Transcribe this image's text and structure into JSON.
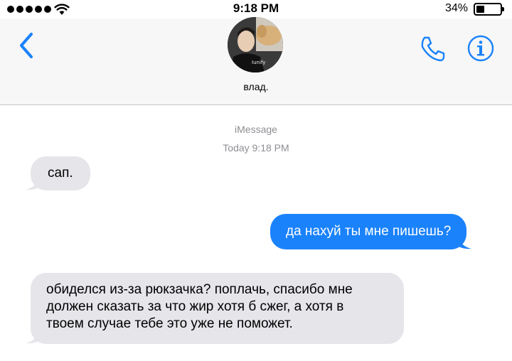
{
  "status_bar": {
    "time": "9:18 PM",
    "battery_percent": "34%",
    "battery_level": 0.34,
    "signal_bars": 5
  },
  "header": {
    "contact_name": "влад.",
    "back_icon": "chevron-left-icon",
    "call_icon": "phone-icon",
    "info_icon": "info-icon",
    "accent_color": "#1a82fb"
  },
  "thread": {
    "service": "iMessage",
    "timestamp": "Today 9:18 PM",
    "messages": [
      {
        "direction": "incoming",
        "text": "сап."
      },
      {
        "direction": "outgoing",
        "text": "да нахуй ты мне пишешь?"
      },
      {
        "direction": "incoming",
        "text": "обиделся из-за рюкзачка? поплачь, спасибо мне\nдолжен сказать за что жир хотя б сжег, а хотя в\nтвоем случае тебе это уже не поможет."
      }
    ]
  },
  "colors": {
    "incoming_bubble": "#e5e5ea",
    "outgoing_bubble": "#1a82fb",
    "meta_text": "#8e8e93"
  }
}
